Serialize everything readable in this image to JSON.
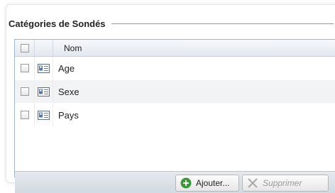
{
  "panel": {
    "title": "Catégories de Sondés"
  },
  "grid": {
    "columns": [
      {
        "key": "select",
        "label": ""
      },
      {
        "key": "icon",
        "label": ""
      },
      {
        "key": "name",
        "label": "Nom"
      }
    ],
    "rows": [
      {
        "name": "Age",
        "checked": false,
        "icon": "id-card-icon"
      },
      {
        "name": "Sexe",
        "checked": false,
        "icon": "id-card-icon"
      },
      {
        "name": "Pays",
        "checked": false,
        "icon": "id-card-icon"
      }
    ]
  },
  "toolbar": {
    "add_label": "Ajouter...",
    "add_icon": "add-green-icon",
    "delete_label": "Supprimer",
    "delete_icon": "delete-x-icon",
    "delete_disabled": true
  },
  "colors": {
    "header_bg": "#e3e8ef",
    "row_alt_bg": "#f2f3f4",
    "toolbar_bg": "#d3d9e1",
    "add_icon_green": "#3a9a3a"
  }
}
